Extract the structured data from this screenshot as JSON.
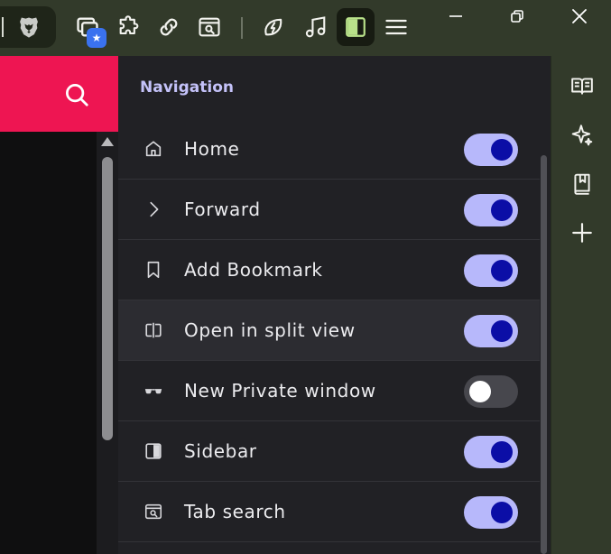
{
  "toolbar": {
    "icons": [
      "brave-lion-icon",
      "window-manager-icon",
      "extensions-icon",
      "link-icon",
      "tab-search-icon",
      "leo-ai-icon",
      "music-icon",
      "sidebar-toggle-icon",
      "menu-icon"
    ],
    "badge_symbol": "★"
  },
  "window_controls": [
    "minimize-icon",
    "restore-icon",
    "close-icon"
  ],
  "page": {
    "header_color": "#ee1552"
  },
  "panel": {
    "title": "Navigation",
    "rows": [
      {
        "label": "Home",
        "icon": "home-icon",
        "enabled": true
      },
      {
        "label": "Forward",
        "icon": "chevron-right-icon",
        "enabled": true
      },
      {
        "label": "Add Bookmark",
        "icon": "bookmark-icon",
        "enabled": true
      },
      {
        "label": "Open in split view",
        "icon": "split-view-icon",
        "enabled": true
      },
      {
        "label": "New Private window",
        "icon": "private-glasses-icon",
        "enabled": false
      },
      {
        "label": "Sidebar",
        "icon": "sidebar-icon",
        "enabled": true
      },
      {
        "label": "Tab search",
        "icon": "tab-search-icon",
        "enabled": true
      }
    ]
  },
  "right_sidebar": {
    "icons": [
      "reading-list-icon",
      "ai-sparkle-icon",
      "bookmarks-icon",
      "add-icon"
    ]
  },
  "colors": {
    "accent_toggle_on": "#b7b8fb",
    "toggle_knob_on": "#0b0ea6",
    "title": "#c4c2f9"
  }
}
